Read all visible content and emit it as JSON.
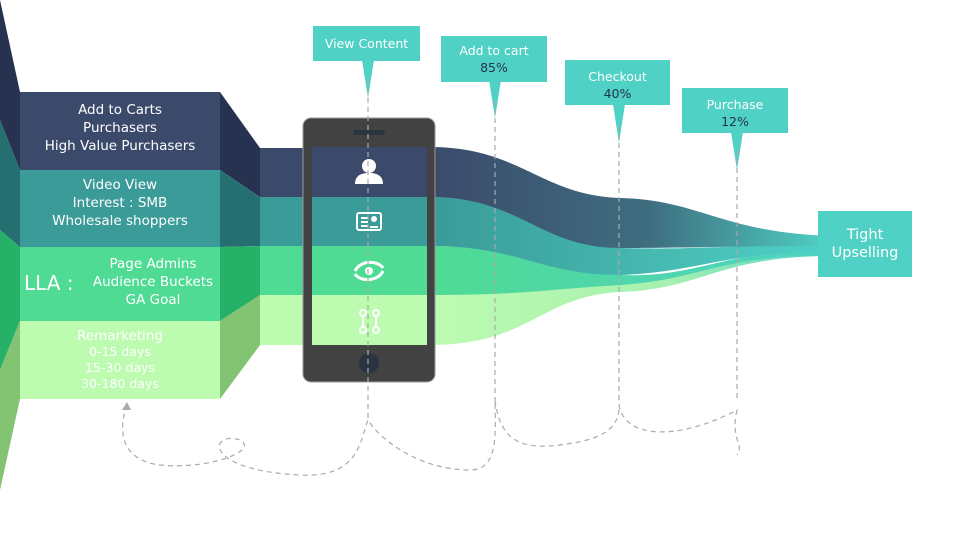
{
  "segments": [
    {
      "lines": [
        "Add to Carts",
        "Purchasers",
        "High Value Purchasers"
      ],
      "color": "#3b4a6b",
      "side": "#26324f",
      "icon": "user-icon"
    },
    {
      "lines": [
        "Video View",
        "Interest : SMB",
        "Wholesale shoppers"
      ],
      "color": "#3a9b98",
      "side": "#256f70",
      "icon": "id-card-icon"
    },
    {
      "prefix": "LLA :",
      "lines": [
        "Page Admins",
        "Audience Buckets",
        "GA Goal"
      ],
      "color": "#4fdb93",
      "side": "#27b068",
      "icon": "eye-cycle-icon"
    },
    {
      "lines": [
        "Remarketing",
        "0-15 days",
        "15-30 days",
        "30-180 days"
      ],
      "color": "#bdfbb0",
      "side": "#82c471",
      "icon": "path-nodes-icon"
    }
  ],
  "stages": [
    {
      "label": "View Content"
    },
    {
      "label": "Add to cart",
      "value": "85%"
    },
    {
      "label": "Checkout",
      "value": "40%"
    },
    {
      "label": "Purchase",
      "value": "12%"
    }
  ],
  "result": {
    "lines": [
      "Tight",
      "Upselling"
    ],
    "color": "#4fd1c5"
  },
  "colors": {
    "accent": "#4fd1c5",
    "phone": "#424242"
  }
}
